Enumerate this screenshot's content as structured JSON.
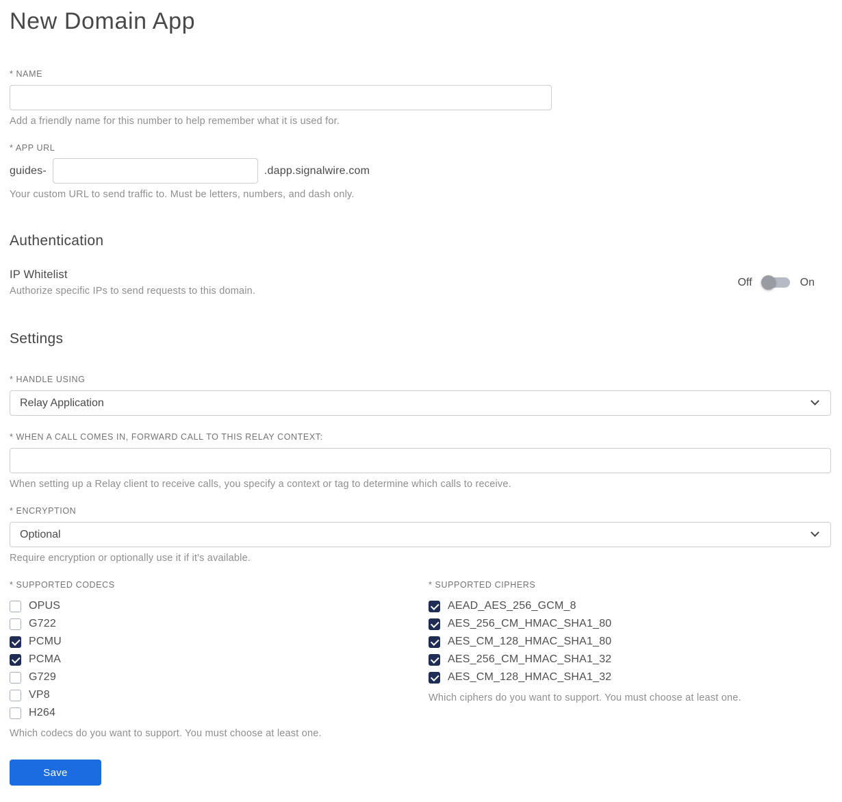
{
  "page": {
    "title": "New Domain App"
  },
  "name_field": {
    "label": "* NAME",
    "value": "",
    "helper": "Add a friendly name for this number to help remember what it is used for."
  },
  "app_url": {
    "label": "* APP URL",
    "prefix": "guides-",
    "value": "",
    "suffix": ".dapp.signalwire.com",
    "helper": "Your custom URL to send traffic to. Must be letters, numbers, and dash only."
  },
  "authentication": {
    "heading": "Authentication",
    "ip_whitelist": {
      "label": "IP Whitelist",
      "helper": "Authorize specific IPs to send requests to this domain.",
      "off_label": "Off",
      "on_label": "On",
      "state": "off"
    }
  },
  "settings": {
    "heading": "Settings",
    "handle_using": {
      "label": "* HANDLE USING",
      "value": "Relay Application"
    },
    "relay_context": {
      "label": "* WHEN A CALL COMES IN, FORWARD CALL TO THIS RELAY CONTEXT:",
      "value": "",
      "helper": "When setting up a Relay client to receive calls, you specify a context or tag to determine which calls to receive."
    },
    "encryption": {
      "label": "* ENCRYPTION",
      "value": "Optional",
      "helper": "Require encryption or optionally use it if it's available."
    },
    "codecs": {
      "label": "* SUPPORTED CODECS",
      "items": [
        {
          "label": "OPUS",
          "checked": false
        },
        {
          "label": "G722",
          "checked": false
        },
        {
          "label": "PCMU",
          "checked": true
        },
        {
          "label": "PCMA",
          "checked": true
        },
        {
          "label": "G729",
          "checked": false
        },
        {
          "label": "VP8",
          "checked": false
        },
        {
          "label": "H264",
          "checked": false
        }
      ],
      "helper": "Which codecs do you want to support. You must choose at least one."
    },
    "ciphers": {
      "label": "* SUPPORTED CIPHERS",
      "items": [
        {
          "label": "AEAD_AES_256_GCM_8",
          "checked": true
        },
        {
          "label": "AES_256_CM_HMAC_SHA1_80",
          "checked": true
        },
        {
          "label": "AES_CM_128_HMAC_SHA1_80",
          "checked": true
        },
        {
          "label": "AES_256_CM_HMAC_SHA1_32",
          "checked": true
        },
        {
          "label": "AES_CM_128_HMAC_SHA1_32",
          "checked": true
        }
      ],
      "helper": "Which ciphers do you want to support. You must choose at least one."
    }
  },
  "actions": {
    "save_label": "Save"
  },
  "colors": {
    "accent_blue": "#1a6ce0",
    "checkbox_navy": "#1f2d55"
  }
}
